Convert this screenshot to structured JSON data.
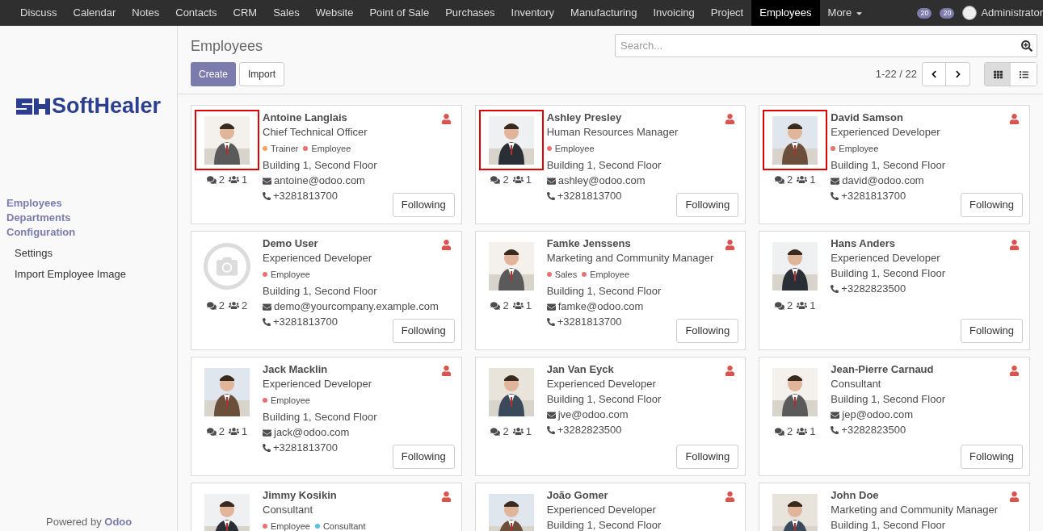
{
  "top_menu": [
    {
      "label": "Discuss",
      "selected": false
    },
    {
      "label": "Calendar",
      "selected": false
    },
    {
      "label": "Notes",
      "selected": false
    },
    {
      "label": "Contacts",
      "selected": false
    },
    {
      "label": "CRM",
      "selected": false
    },
    {
      "label": "Sales",
      "selected": false
    },
    {
      "label": "Website",
      "selected": false
    },
    {
      "label": "Point of Sale",
      "selected": false
    },
    {
      "label": "Purchases",
      "selected": false
    },
    {
      "label": "Inventory",
      "selected": false
    },
    {
      "label": "Manufacturing",
      "selected": false
    },
    {
      "label": "Invoicing",
      "selected": false
    },
    {
      "label": "Project",
      "selected": false
    },
    {
      "label": "Employees",
      "selected": true
    },
    {
      "label": "More",
      "selected": false
    }
  ],
  "systray": {
    "activity_count": "20",
    "message_count": "20",
    "user": "Administrator"
  },
  "sidebar": {
    "logo": "SoftHealer",
    "items": [
      {
        "label": "Employees",
        "kind": "section"
      },
      {
        "label": "Departments",
        "kind": "section"
      },
      {
        "label": "Configuration",
        "kind": "section"
      },
      {
        "label": "Settings",
        "kind": "item"
      },
      {
        "label": "Import Employee Image",
        "kind": "item"
      }
    ],
    "footer": {
      "text": "Powered by ",
      "brand": "Odoo"
    }
  },
  "control_panel": {
    "title": "Employees",
    "search": {
      "placeholder": "Search..."
    },
    "buttons": [
      "Create",
      "Import"
    ],
    "pager": "1-22 / 22",
    "views": [
      {
        "kind": "kanban",
        "selected": true
      },
      {
        "kind": "list",
        "selected": false
      }
    ]
  },
  "employees": [
    {
      "name": "Antoine Langlais",
      "job": "Chief Technical Officer",
      "tags": [
        {
          "label": "Trainer",
          "color": "#f4a460"
        },
        {
          "label": "Employee",
          "color": "#e57373"
        }
      ],
      "location": "Building 1, Second Floor",
      "email": "antoine@odoo.com",
      "phone": "+3281813700",
      "messages": "2",
      "followers": "1",
      "button": "Following",
      "photo": {
        "kind": "picture"
      },
      "highlighted": true
    },
    {
      "name": "Ashley Presley",
      "job": "Human Resources Manager",
      "tags": [
        {
          "label": "Employee",
          "color": "#e57373"
        }
      ],
      "location": "Building 1, Second Floor",
      "email": "ashley@odoo.com",
      "phone": "+3281813700",
      "messages": "2",
      "followers": "1",
      "button": "Following",
      "photo": {
        "kind": "picture"
      },
      "highlighted": true
    },
    {
      "name": "David Samson",
      "job": "Experienced Developer",
      "tags": [
        {
          "label": "Employee",
          "color": "#e57373"
        }
      ],
      "location": "Building 1, Second Floor",
      "email": "david@odoo.com",
      "phone": "+3281813700",
      "messages": "2",
      "followers": "1",
      "button": "Following",
      "photo": {
        "kind": "picture"
      },
      "highlighted": true
    },
    {
      "name": "Demo User",
      "job": "Experienced Developer",
      "tags": [
        {
          "label": "Employee",
          "color": "#e57373"
        }
      ],
      "location": "Building 1, Second Floor",
      "email": "demo@yourcompany.example.com",
      "phone": "+3281813700",
      "messages": "2",
      "followers": "2",
      "button": "Following",
      "photo": {
        "kind": "placeholder"
      },
      "highlighted": false
    },
    {
      "name": "Famke Jenssens",
      "job": "Marketing and Community Manager",
      "tags": [
        {
          "label": "Sales",
          "color": "#e57373"
        },
        {
          "label": "Employee",
          "color": "#e57373"
        }
      ],
      "location": "Building 1, Second Floor",
      "email": "famke@odoo.com",
      "phone": "+3281813700",
      "messages": "2",
      "followers": "1",
      "button": "Following",
      "photo": {
        "kind": "picture"
      },
      "highlighted": false
    },
    {
      "name": "Hans Anders",
      "job": "Experienced Developer",
      "location": "Building 1, Second Floor",
      "phone": "+3282823500",
      "messages": "2",
      "followers": "1",
      "button": "Following",
      "photo": {
        "kind": "picture"
      },
      "highlighted": false
    },
    {
      "name": "Jack Macklin",
      "job": "Experienced Developer",
      "tags": [
        {
          "label": "Employee",
          "color": "#e57373"
        }
      ],
      "location": "Building 1, Second Floor",
      "email": "jack@odoo.com",
      "phone": "+3281813700",
      "messages": "2",
      "followers": "1",
      "button": "Following",
      "photo": {
        "kind": "picture"
      },
      "highlighted": false
    },
    {
      "name": "Jan Van Eyck",
      "job": "Experienced Developer",
      "location": "Building 1, Second Floor",
      "email": "jve@odoo.com",
      "phone": "+3282823500",
      "messages": "2",
      "followers": "1",
      "button": "Following",
      "photo": {
        "kind": "picture"
      },
      "highlighted": false
    },
    {
      "name": "Jean-Pierre Carnaud",
      "job": "Consultant",
      "location": "Building 1, Second Floor",
      "email": "jep@odoo.com",
      "phone": "+3282823500",
      "messages": "2",
      "followers": "1",
      "button": "Following",
      "photo": {
        "kind": "picture"
      },
      "highlighted": false
    },
    {
      "name": "Jimmy Kosikin",
      "job": "Consultant",
      "tags": [
        {
          "label": "Employee",
          "color": "#e57373"
        },
        {
          "label": "Consultant",
          "color": "#5bc0de"
        }
      ],
      "photo": {
        "kind": "picture"
      },
      "highlighted": false
    },
    {
      "name": "João Gomer",
      "job": "Experienced Developer",
      "location": "Building 1, Second Floor",
      "photo": {
        "kind": "picture"
      },
      "highlighted": false
    },
    {
      "name": "John Doe",
      "job": "Marketing and Community Manager",
      "location": "Building 1, Second Floor",
      "photo": {
        "kind": "picture"
      },
      "highlighted": false
    }
  ]
}
